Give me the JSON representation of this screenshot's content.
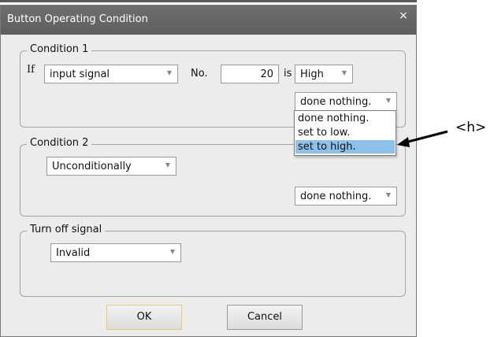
{
  "dialog": {
    "title": "Button Operating Condition",
    "close_symbol": "×"
  },
  "condition1": {
    "legend": "Condition 1",
    "if_label": "If",
    "signal_type": "input signal",
    "no_label": "No.",
    "number": "20",
    "is_label": "is",
    "state": "High",
    "action": "done nothing.",
    "action_options": [
      "done nothing.",
      "set to low.",
      "set to high."
    ],
    "highlighted_option": "set to high."
  },
  "condition2": {
    "legend": "Condition 2",
    "mode": "Unconditionally",
    "action": "done nothing."
  },
  "turn_off": {
    "legend": "Turn off signal",
    "value": "Invalid"
  },
  "buttons": {
    "ok": "OK",
    "cancel": "Cancel"
  },
  "annotation": {
    "text": "<h>"
  },
  "colors": {
    "titlebar": "#666666",
    "dialog_bg": "#ececec",
    "highlight": "#8ec1ea",
    "default_button_border": "#e8cf6a"
  }
}
